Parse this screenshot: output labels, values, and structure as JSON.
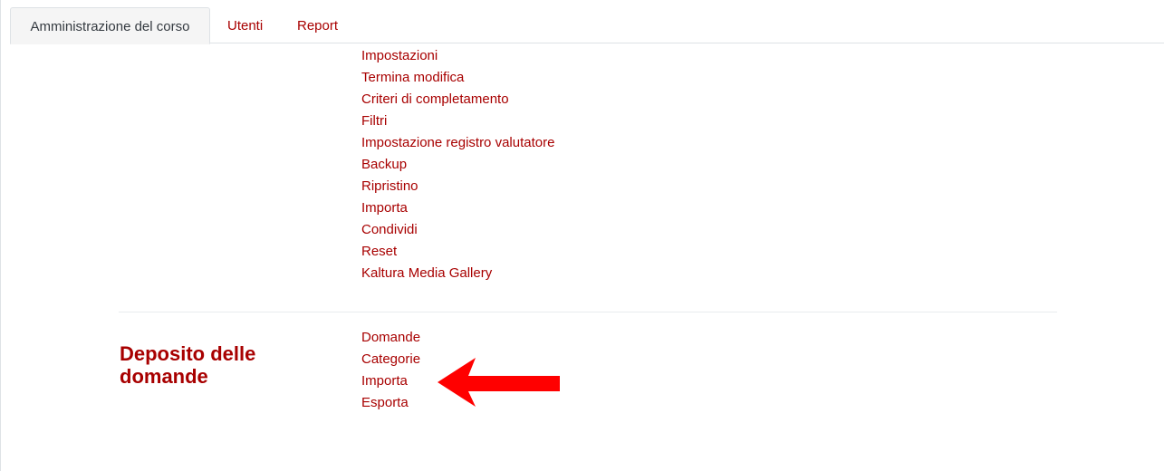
{
  "tabs": [
    {
      "label": "Amministrazione del corso",
      "active": true
    },
    {
      "label": "Utenti",
      "active": false
    },
    {
      "label": "Report",
      "active": false
    }
  ],
  "course_admin_links": [
    "Impostazioni",
    "Termina modifica",
    "Criteri di completamento",
    "Filtri",
    "Impostazione registro valutatore",
    "Backup",
    "Ripristino",
    "Importa",
    "Condividi",
    "Reset",
    "Kaltura Media Gallery"
  ],
  "question_bank": {
    "title": "Deposito delle domande",
    "links": [
      "Domande",
      "Categorie",
      "Importa",
      "Esporta"
    ]
  },
  "colors": {
    "link": "#a80000",
    "annotation_arrow": "#ff0000",
    "active_tab_bg": "#f5f5f5"
  },
  "annotation": {
    "icon": "red-arrow-icon",
    "points_to": "Importa"
  }
}
